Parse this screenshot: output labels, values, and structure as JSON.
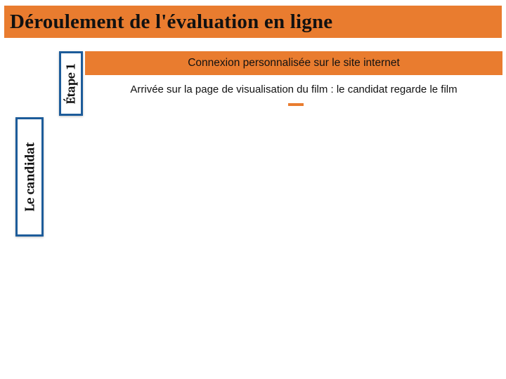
{
  "title": "Déroulement de l'évaluation en ligne",
  "etape": {
    "label": "Étape 1"
  },
  "candidat": {
    "label": "Le candidat"
  },
  "subbar": {
    "label": "Connexion personnalisée sur le site internet"
  },
  "desc": "Arrivée sur la page de visualisation du film : le candidat regarde le film",
  "colors": {
    "accent": "#e97c2f",
    "frame": "#1d5c9a"
  }
}
